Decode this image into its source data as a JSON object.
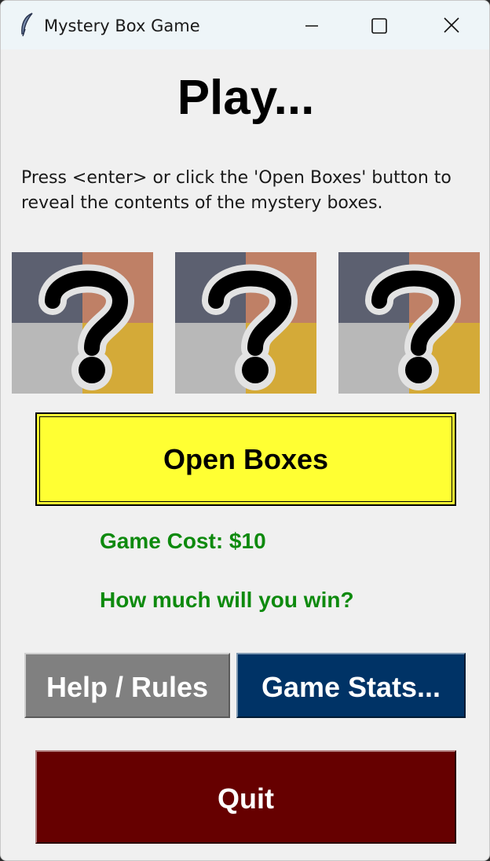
{
  "window": {
    "title": "Mystery Box Game",
    "icon": "feather-icon",
    "controls": [
      "minimize-icon",
      "maximize-icon",
      "close-icon"
    ]
  },
  "main": {
    "heading": "Play...",
    "instructions": "Press <enter> or click the 'Open Boxes' button to reveal the contents of the mystery boxes.",
    "boxes": [
      {
        "icon": "question-mark-icon"
      },
      {
        "icon": "question-mark-icon"
      },
      {
        "icon": "question-mark-icon"
      }
    ],
    "open_button": "Open Boxes",
    "game_cost": "Game Cost: $10",
    "win_prompt": "How much will you win?",
    "help_button": "Help / Rules",
    "stats_button": "Game Stats...",
    "quit_button": "Quit"
  },
  "colors": {
    "open_button_bg": "#ffff33",
    "info_text": "#0e8a0e",
    "help_button_bg": "#808080",
    "stats_button_bg": "#003366",
    "quit_button_bg": "#660000",
    "box_quadrants": [
      "#5c6070",
      "#bf8066",
      "#b8b8b8",
      "#d4aa38"
    ]
  }
}
